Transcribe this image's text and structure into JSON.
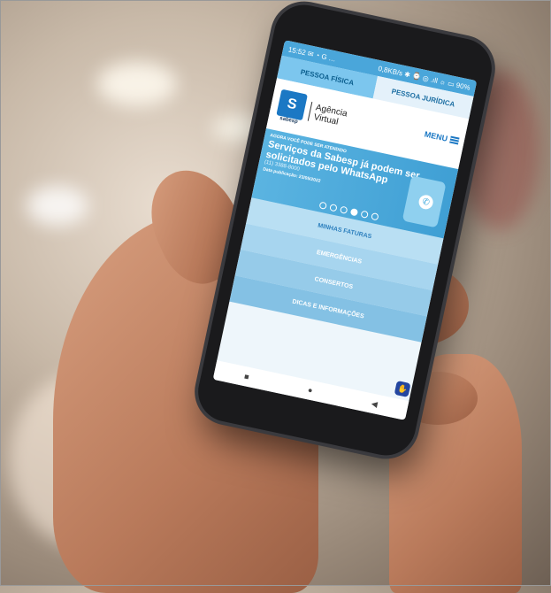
{
  "status_bar": {
    "time": "15:52",
    "left_icons": "✉ ◔ G …",
    "right_info": "0,8KB/s ✱ ⌚ ◎ .ıll ☼ ▭ 90%"
  },
  "tabs": [
    {
      "label": "PESSOA FÍSICA",
      "active": true
    },
    {
      "label": "PESSOA JURÍDICA",
      "active": false
    }
  ],
  "header": {
    "logo_text": "S",
    "logo_sub": "sabesp",
    "agency_line1": "Agência",
    "agency_line2": "Virtual",
    "menu_label": "MENU"
  },
  "banner": {
    "small": "AGORA VOCÊ PODE SER ATENDIDO",
    "title": "Serviços da Sabesp já podem ser solicitados pelo WhatsApp",
    "phone": "(11) 3388-8000",
    "date": "Data publicação: 23/05/2022",
    "dots_total": 6,
    "dots_active_index": 3
  },
  "menu_items": [
    {
      "label": "MINHAS FATURAS"
    },
    {
      "label": "EMERGÊNCIAS"
    },
    {
      "label": "CONSERTOS"
    },
    {
      "label": "DICAS E INFORMAÇÕES"
    }
  ],
  "navbar": {
    "square": "■",
    "circle": "●",
    "back": "◀"
  },
  "accessibility_icon": "hand-icon",
  "colors": {
    "brand_blue": "#1b78c4",
    "banner_blue": "#3f9fd4",
    "tab_active": "#7cc6ee"
  }
}
